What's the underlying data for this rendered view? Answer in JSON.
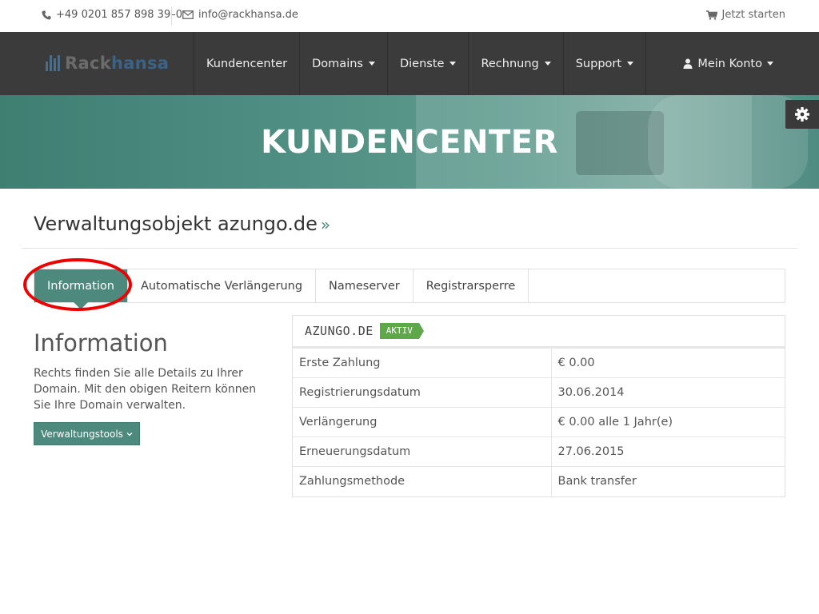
{
  "topbar": {
    "phone": "+49 0201 857 898 39–0",
    "email": "info@rackhansa.de",
    "cart_label": "Jetzt starten"
  },
  "logo": {
    "part1": "Rack",
    "part2": "hansa"
  },
  "nav": {
    "items": [
      {
        "label": "Kundencenter",
        "dropdown": false
      },
      {
        "label": "Domains",
        "dropdown": true
      },
      {
        "label": "Dienste",
        "dropdown": true
      },
      {
        "label": "Rechnung",
        "dropdown": true
      },
      {
        "label": "Support",
        "dropdown": true
      }
    ],
    "account_label": "Mein Konto"
  },
  "hero": {
    "title": "KUNDENCENTER"
  },
  "page": {
    "title": "Verwaltungsobjekt azungo.de",
    "title_suffix": "»"
  },
  "tabs": [
    {
      "label": "Information",
      "active": true
    },
    {
      "label": "Automatische Verlängerung",
      "active": false
    },
    {
      "label": "Nameserver",
      "active": false
    },
    {
      "label": "Registrarsperre",
      "active": false
    }
  ],
  "info": {
    "heading": "Information",
    "text": "Rechts finden Sie alle Details zu Ihrer Domain. Mit den obigen Reitern können Sie Ihre Domain verwalten.",
    "button_label": "Verwaltungstools"
  },
  "panel": {
    "domain": "AZUNGO.DE",
    "status": "AKTIV",
    "rows": [
      {
        "label": "Erste Zahlung",
        "value": "€ 0.00"
      },
      {
        "label": "Registrierungsdatum",
        "value": "30.06.2014"
      },
      {
        "label": "Verlängerung",
        "value": "€ 0.00 alle 1 Jahr(e)"
      },
      {
        "label": "Erneuerungsdatum",
        "value": "27.06.2015"
      },
      {
        "label": "Zahlungsmethode",
        "value": "Bank transfer"
      }
    ]
  },
  "colors": {
    "accent": "#4d8a7d",
    "navbar": "#3b3b3b",
    "status_green": "#5fa84a",
    "highlight_ring": "#e00000"
  }
}
